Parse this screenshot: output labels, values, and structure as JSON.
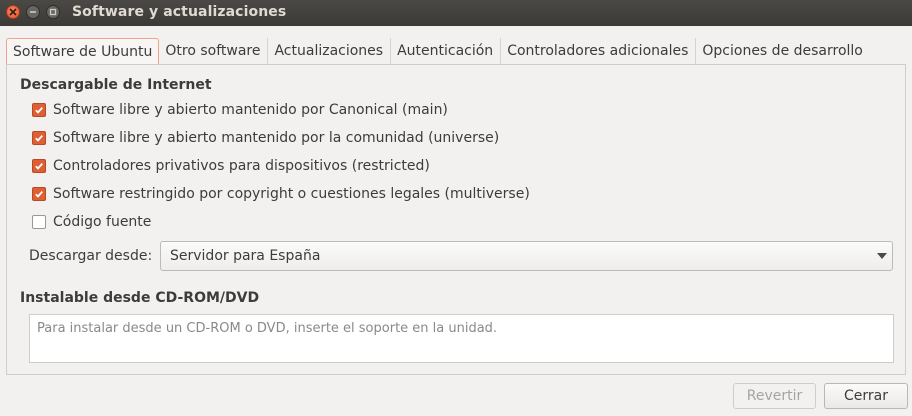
{
  "window": {
    "title": "Software y actualizaciones",
    "controls": [
      "close-icon",
      "minimize-icon",
      "maximize-icon"
    ]
  },
  "tabs": [
    {
      "label": "Software de Ubuntu",
      "active": true
    },
    {
      "label": "Otro software",
      "active": false
    },
    {
      "label": "Actualizaciones",
      "active": false
    },
    {
      "label": "Autenticación",
      "active": false
    },
    {
      "label": "Controladores adicionales",
      "active": false
    },
    {
      "label": "Opciones de desarrollo",
      "active": false
    }
  ],
  "internet": {
    "title": "Descargable de Internet",
    "options": [
      {
        "label": "Software libre y abierto mantenido por Canonical (main)",
        "checked": true
      },
      {
        "label": "Software libre y abierto mantenido por la comunidad (universe)",
        "checked": true
      },
      {
        "label": "Controladores privativos para dispositivos (restricted)",
        "checked": true
      },
      {
        "label": "Software restringido por copyright o cuestiones legales (multiverse)",
        "checked": true
      },
      {
        "label": "Código fuente",
        "checked": false
      }
    ],
    "download_from_label": "Descargar desde:",
    "download_from_value": "Servidor para España"
  },
  "cdrom": {
    "title": "Instalable desde CD-ROM/DVD",
    "placeholder": "Para instalar desde un CD-ROM o DVD, inserte el soporte en la unidad."
  },
  "buttons": {
    "revert": "Revertir",
    "close": "Cerrar"
  },
  "colors": {
    "accent": "#e05e33",
    "titlebar": "#3c3b37",
    "close_button": "#e1532a"
  }
}
